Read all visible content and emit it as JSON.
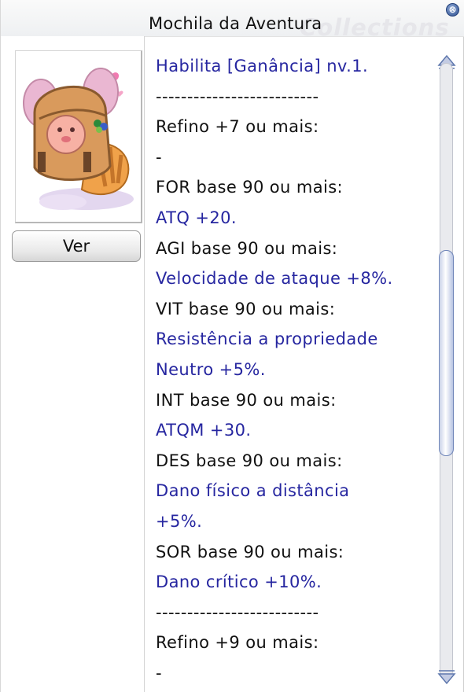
{
  "window": {
    "title": "Mochila da Aventura",
    "watermark": "Collections",
    "close_glyph": "⊗"
  },
  "preview": {
    "image_icon": "adventure-backpack-icon",
    "view_button_label": "Ver"
  },
  "description": {
    "lines": [
      {
        "text": "Habilita [Ganância] nv.1.",
        "style": "blue"
      },
      {
        "text": "--------------------------",
        "style": "black"
      },
      {
        "text": "Refino +7 ou mais:",
        "style": "black"
      },
      {
        "text": "-",
        "style": "black"
      },
      {
        "text": "FOR base 90 ou mais:",
        "style": "black"
      },
      {
        "text": "ATQ +20.",
        "style": "blue"
      },
      {
        "text": "AGI base 90 ou mais:",
        "style": "black"
      },
      {
        "text": "Velocidade de ataque +8%.",
        "style": "blue"
      },
      {
        "text": "VIT base 90 ou mais:",
        "style": "black"
      },
      {
        "text": "Resistência a propriedade",
        "style": "blue"
      },
      {
        "text": "Neutro +5%.",
        "style": "blue"
      },
      {
        "text": "INT base 90 ou mais:",
        "style": "black"
      },
      {
        "text": "ATQM +30.",
        "style": "blue"
      },
      {
        "text": "DES base 90 ou mais:",
        "style": "black"
      },
      {
        "text": "Dano físico a distância",
        "style": "blue"
      },
      {
        "text": "+5%.",
        "style": "blue"
      },
      {
        "text": "SOR base 90 ou mais:",
        "style": "black"
      },
      {
        "text": "Dano crítico +10%.",
        "style": "blue"
      },
      {
        "text": "--------------------------",
        "style": "black"
      },
      {
        "text": "Refino +9 ou mais:",
        "style": "black"
      },
      {
        "text": "-",
        "style": "black"
      }
    ]
  },
  "colors": {
    "effect_text": "#2626a0",
    "condition_text": "#111111"
  }
}
